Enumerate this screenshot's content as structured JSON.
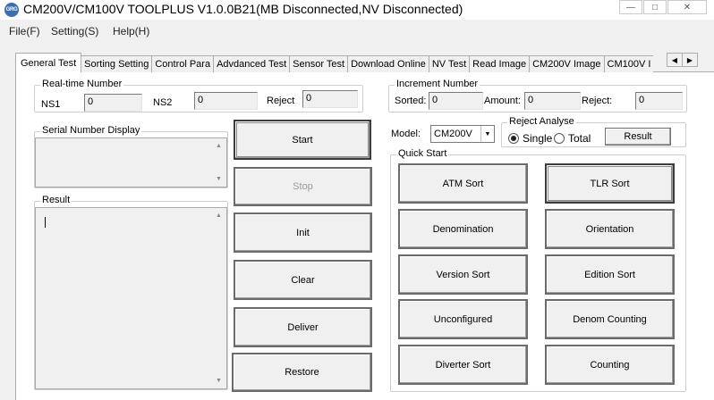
{
  "window": {
    "logo_text": "GRG",
    "title": "CM200V/CM100V TOOLPLUS V1.0.0B21(MB Disconnected,NV Disconnected)"
  },
  "menu": [
    "File(F)",
    "Setting(S)",
    "Help(H)"
  ],
  "tabs": [
    "General Test",
    "Sorting Setting",
    "Control Para",
    "Advdanced Test",
    "Sensor Test",
    "Download Online",
    "NV Test",
    "Read Image",
    "CM200V Image",
    "CM100V I"
  ],
  "realtime": {
    "group_label": "Real-time Number",
    "ns1_label": "NS1",
    "ns1_value": "0",
    "ns2_label": "NS2",
    "ns2_value": "0",
    "reject_label": "Reject",
    "reject_value": "0"
  },
  "serial": {
    "group_label": "Serial Number Display"
  },
  "result": {
    "group_label": "Result"
  },
  "left_buttons": {
    "start": "Start",
    "stop": "Stop",
    "init": "Init",
    "clear": "Clear",
    "deliver": "Deliver",
    "restore": "Restore"
  },
  "increment": {
    "group_label": "Increment Number",
    "sorted_label": "Sorted:",
    "sorted_value": "0",
    "amount_label": "Amount:",
    "amount_value": "0",
    "reject_label": "Reject:",
    "reject_value": "0"
  },
  "model": {
    "label": "Model:",
    "value": "CM200V"
  },
  "reject_analyse": {
    "group_label": "Reject Analyse",
    "single_label": "Single",
    "total_label": "Total",
    "selected": "Single",
    "result_button": "Result"
  },
  "quick_start": {
    "group_label": "Quick Start",
    "buttons": {
      "atm_sort": "ATM Sort",
      "tlr_sort": "TLR Sort",
      "denomination": "Denomination",
      "orientation": "Orientation",
      "version_sort": "Version Sort",
      "edition_sort": "Edition Sort",
      "unconfigured": "Unconfigured",
      "denom_counting": "Denom Counting",
      "diverter_sort": "Diverter Sort",
      "counting": "Counting"
    }
  }
}
